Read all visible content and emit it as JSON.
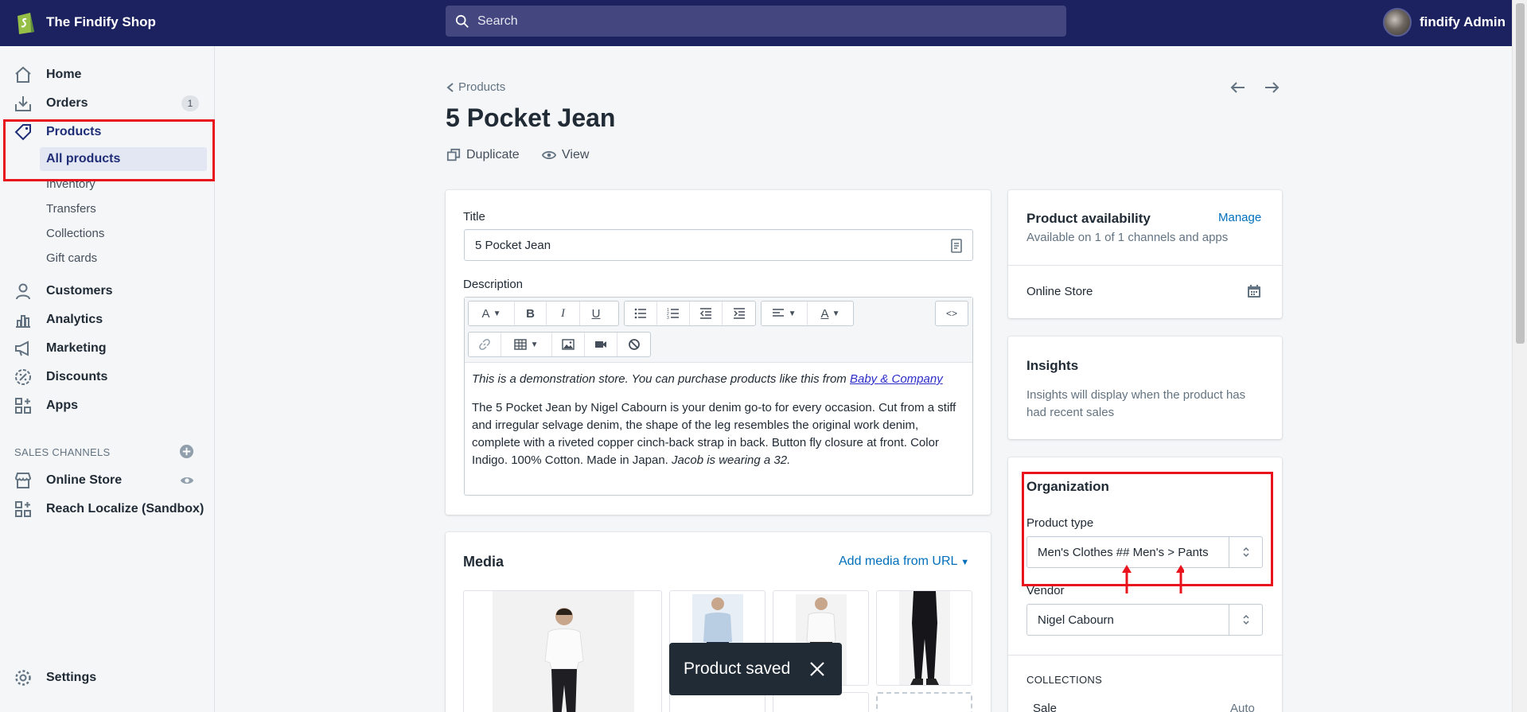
{
  "app": {
    "shop_name": "The Findify Shop",
    "search_placeholder": "Search",
    "admin_name": "findify Admin"
  },
  "sidebar": {
    "items": [
      {
        "label": "Home",
        "icon": "home-icon"
      },
      {
        "label": "Orders",
        "icon": "orders-icon",
        "badge": "1"
      },
      {
        "label": "Products",
        "icon": "tag-icon"
      },
      {
        "label": "Customers",
        "icon": "person-icon"
      },
      {
        "label": "Analytics",
        "icon": "bar-chart-icon"
      },
      {
        "label": "Marketing",
        "icon": "megaphone-icon"
      },
      {
        "label": "Discounts",
        "icon": "discount-icon"
      },
      {
        "label": "Apps",
        "icon": "apps-icon"
      }
    ],
    "product_sub": [
      "All products",
      "Inventory",
      "Transfers",
      "Collections",
      "Gift cards"
    ],
    "sales_channels_title": "SALES CHANNELS",
    "channels": [
      {
        "label": "Online Store",
        "icon": "store-icon"
      },
      {
        "label": "Reach Localize (Sandbox)",
        "icon": "apps-icon"
      }
    ],
    "settings": "Settings"
  },
  "main": {
    "breadcrumb": "Products",
    "title": "5 Pocket Jean",
    "actions": {
      "duplicate": "Duplicate",
      "view": "View"
    },
    "title_label": "Title",
    "title_value": "5 Pocket Jean",
    "description_label": "Description",
    "description": {
      "intro": "This is a demonstration store. You can purchase products like this from ",
      "intro_link": "Baby & Company",
      "body": "The 5 Pocket Jean by Nigel Cabourn is your denim go-to for every occasion. Cut from a stiff and irregular selvage denim, the shape of the leg resembles the original work denim, complete with a riveted copper cinch-back strap in back. Button fly closure at front. Color Indigo. 100% Cotton. Made in Japan. ",
      "body_italic": "Jacob is wearing a 32."
    },
    "toolbar": {
      "font": "A",
      "bold": "B",
      "italic": "I",
      "underline": "U",
      "color": "A",
      "html": "<>"
    },
    "media": {
      "title": "Media",
      "add_link": "Add media from URL"
    }
  },
  "right": {
    "availability": {
      "title": "Product availability",
      "manage": "Manage",
      "subtitle": "Available on 1 of 1 channels and apps",
      "channel": "Online Store"
    },
    "insights": {
      "title": "Insights",
      "text": "Insights will display when the product has had recent sales"
    },
    "organization": {
      "title": "Organization",
      "product_type_label": "Product type",
      "product_type_value": "Men's Clothes ## Men's > Pants",
      "vendor_label": "Vendor",
      "vendor_value": "Nigel Cabourn",
      "collections_title": "COLLECTIONS",
      "collection_partial": "Sale",
      "collection_partial_right": "Auto"
    }
  },
  "toast": {
    "message": "Product saved"
  },
  "colors": {
    "topbar": "#1c2260",
    "accent": "#e8131c",
    "link": "#006fbb"
  }
}
